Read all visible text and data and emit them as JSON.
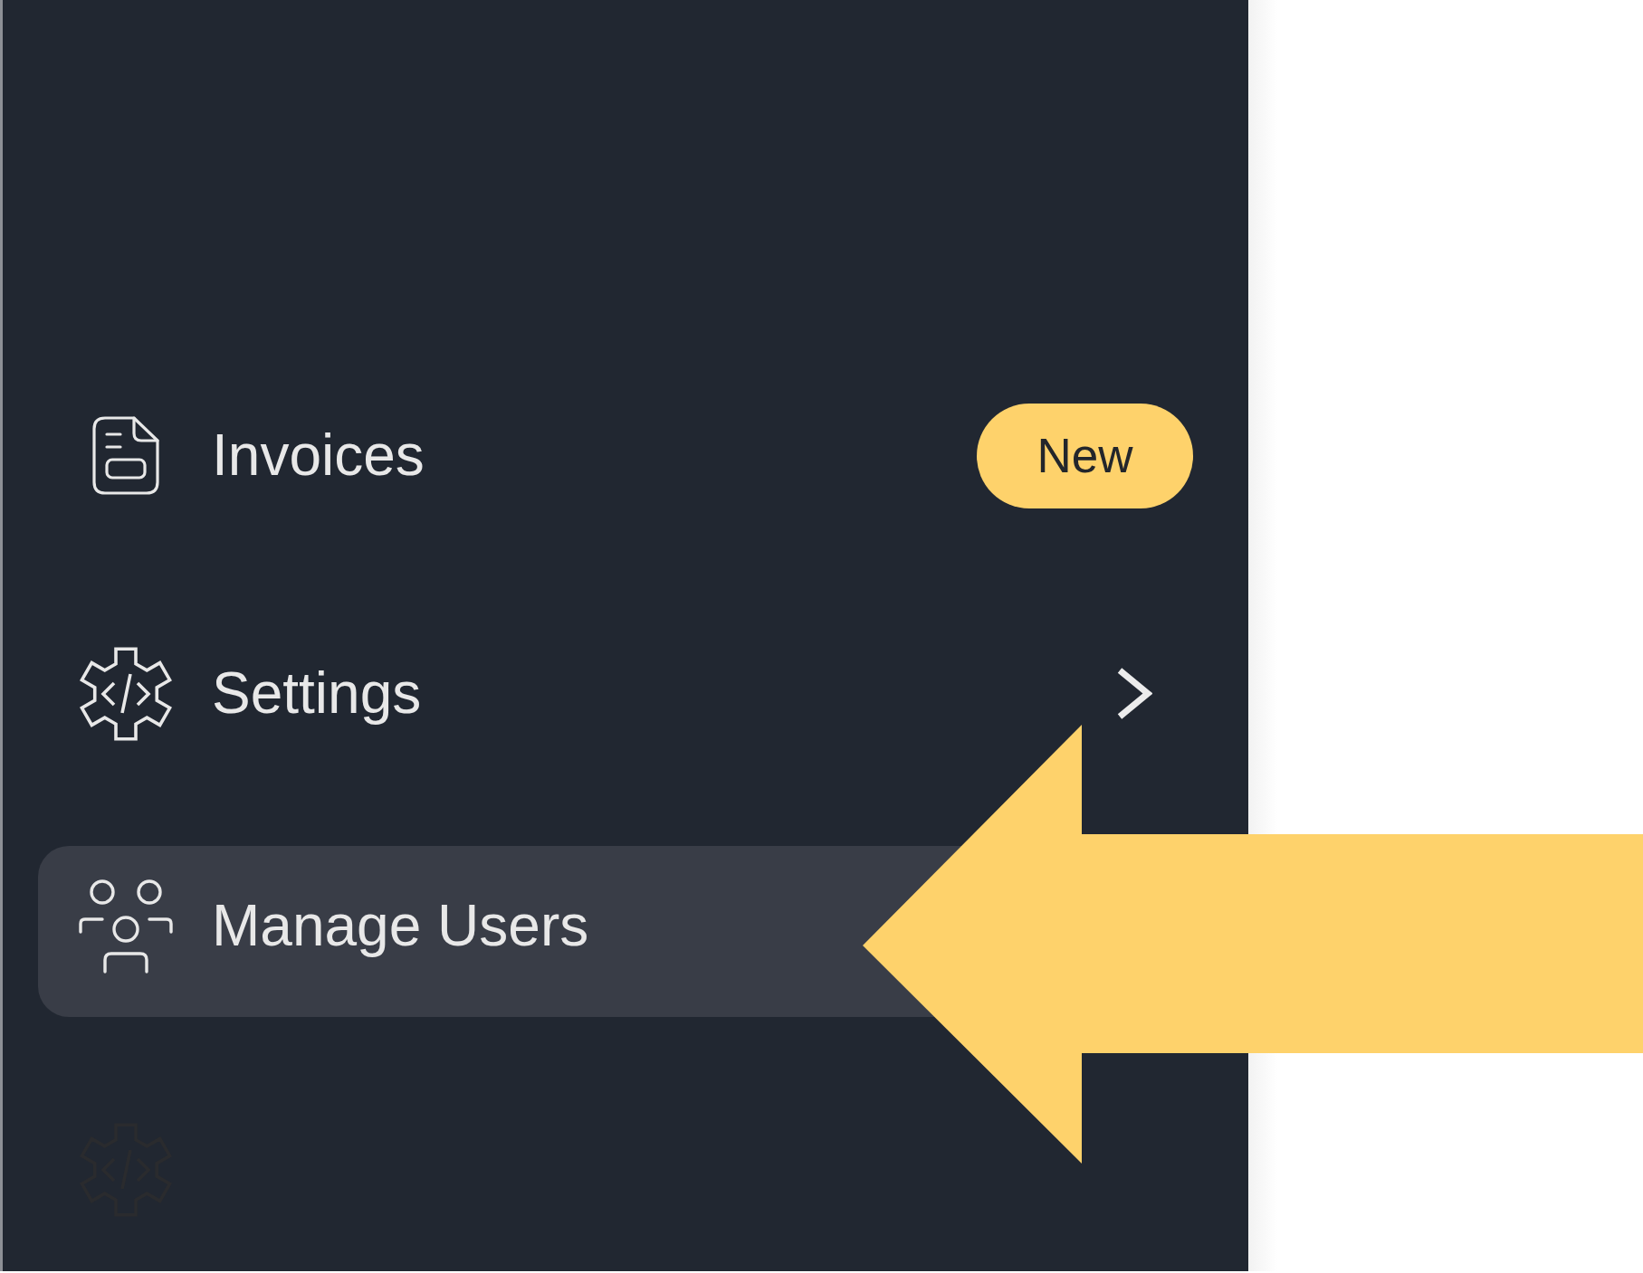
{
  "sidebar": {
    "items": [
      {
        "kind": "badge",
        "label": "Invoices",
        "badge": "New",
        "selected": false,
        "disabled": false
      },
      {
        "kind": "group",
        "label": "Settings",
        "expanded": false,
        "selected": false,
        "disabled": false
      },
      {
        "kind": "link",
        "label": "Manage Users",
        "selected": true,
        "disabled": false
      },
      {
        "kind": "link",
        "selected": false,
        "disabled": true
      }
    ]
  }
}
